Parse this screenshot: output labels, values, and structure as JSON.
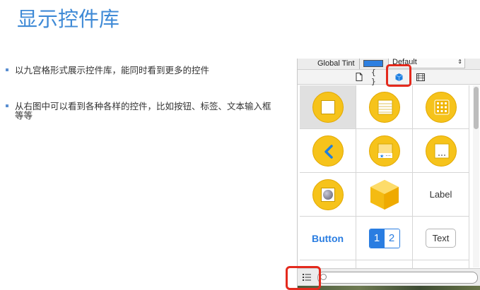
{
  "slide": {
    "title": "显示控件库",
    "bullets": [
      "以九宫格形式展示控件库，能同时看到更多的控件",
      "从右图中可以看到各种各样的控件，比如按钮、标签、文本输入框等等"
    ]
  },
  "inspector": {
    "tint_label": "Global Tint",
    "tint_color": "#2d7fe0",
    "tint_select_value": "Default",
    "tabs": [
      "file-template-icon",
      "code-snippet-icon",
      "object-library-icon",
      "media-library-icon"
    ],
    "active_tab": "object-library-icon"
  },
  "library": {
    "items": [
      {
        "kind": "icon",
        "name": "view-controller-icon"
      },
      {
        "kind": "icon",
        "name": "table-view-controller-icon"
      },
      {
        "kind": "icon",
        "name": "collection-view-controller-icon"
      },
      {
        "kind": "icon",
        "name": "navigation-controller-icon"
      },
      {
        "kind": "icon",
        "name": "tab-bar-controller-icon"
      },
      {
        "kind": "icon",
        "name": "page-view-controller-icon"
      },
      {
        "kind": "icon",
        "name": "glkit-view-controller-icon"
      },
      {
        "kind": "icon",
        "name": "object-cube-icon"
      },
      {
        "kind": "text",
        "label": "Label"
      },
      {
        "kind": "button",
        "label": "Button"
      },
      {
        "kind": "segmented",
        "seg1": "1",
        "seg2": "2"
      },
      {
        "kind": "textfield",
        "label": "Text"
      }
    ]
  },
  "bottom": {
    "view_mode_icon": "list-view-icon",
    "filter_placeholder": ""
  },
  "colors": {
    "title": "#3f8ad6",
    "highlight": "#e42a1d",
    "icon_yellow": "#f6c31b",
    "accent_blue": "#2a7de1"
  }
}
